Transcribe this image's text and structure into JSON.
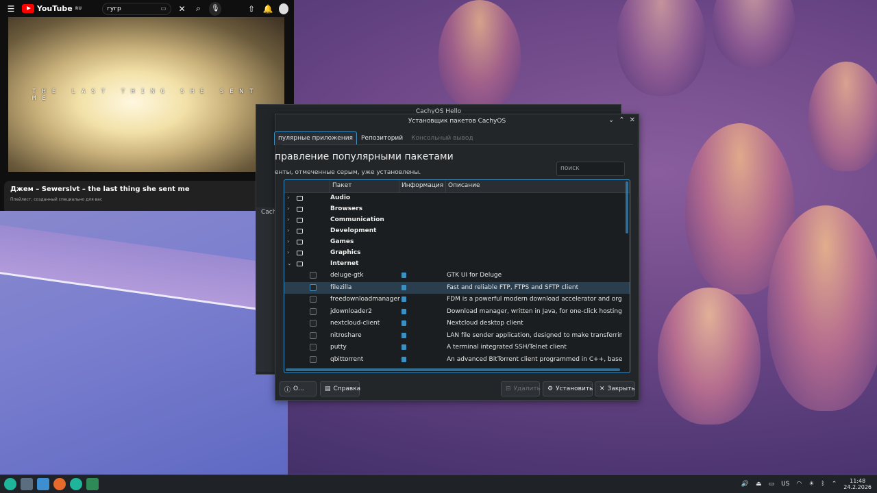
{
  "youtube": {
    "logo": "YouTube",
    "region": "RU",
    "search_value": "гугр",
    "video_caption": "THE LAST THING SHE SENT ME",
    "video_title": "Джем – Sewerslvt – the last thing she sent me",
    "video_subtitle": "Плейлист, созданный специально для вас"
  },
  "hello_window": {
    "title": "CachyOS Hello",
    "side_label": "Cach"
  },
  "installer": {
    "title": "Установщик пакетов CachyOS",
    "tabs": [
      {
        "label": "пулярные приложения"
      },
      {
        "label": "Репозиторий"
      },
      {
        "label": "Консольный вывод"
      }
    ],
    "heading": "правление популярными пакетами",
    "subheading": "енты, отмеченные серым, уже установлены.",
    "search_placeholder": "поиск",
    "columns": [
      "Пакет",
      "Информация",
      "Описание"
    ],
    "categories": [
      "Audio",
      "Browsers",
      "Communication",
      "Development",
      "Games",
      "Graphics",
      "Internet"
    ],
    "packages": [
      {
        "name": "deluge-gtk",
        "description": "GTK UI for Deluge"
      },
      {
        "name": "filezilla",
        "description": "Fast and reliable FTP, FTPS and SFTP client"
      },
      {
        "name": "freedownloadmanager",
        "description": "FDM is a powerful modern download accelerator and organizer"
      },
      {
        "name": "jdownloader2",
        "description": "Download manager, written in Java, for one-click hosting sites l"
      },
      {
        "name": "nextcloud-client",
        "description": "Nextcloud desktop client"
      },
      {
        "name": "nitroshare",
        "description": "LAN file sender application, designed to make transferring files"
      },
      {
        "name": "putty",
        "description": "A terminal integrated SSH/Telnet client"
      },
      {
        "name": "qbittorrent",
        "description": "An advanced BitTorrent client programmed in C++, based on Q"
      }
    ],
    "buttons": {
      "about": "О...",
      "help": "Справка",
      "remove": "Удалить",
      "install": "Установить",
      "close": "Закрыть"
    }
  },
  "taskbar": {
    "keyboard_layout": "US",
    "time": "11:48",
    "date": "24.2.2026"
  }
}
